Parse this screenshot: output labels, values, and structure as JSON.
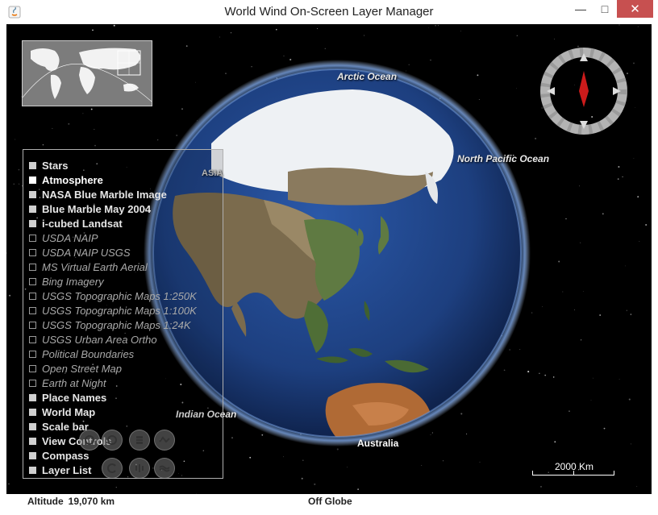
{
  "window": {
    "title": "World Wind On-Screen Layer Manager",
    "controls": {
      "minimize": "—",
      "maximize": "□",
      "close": "✕"
    }
  },
  "globe": {
    "labels": {
      "arctic": "Arctic Ocean",
      "north_pacific": "North Pacific Ocean",
      "asia": "ASIA",
      "indian": "Indian Ocean",
      "australia": "Australia"
    }
  },
  "layers": [
    {
      "label": "Stars",
      "enabled": true
    },
    {
      "label": "Atmosphere",
      "enabled": true,
      "highlighted": true
    },
    {
      "label": "NASA  Blue Marble Image",
      "enabled": true
    },
    {
      "label": "Blue Marble May 2004",
      "enabled": true
    },
    {
      "label": "i-cubed Landsat",
      "enabled": true
    },
    {
      "label": "USDA NAIP",
      "enabled": false
    },
    {
      "label": "USDA NAIP USGS",
      "enabled": false
    },
    {
      "label": "MS Virtual Earth Aerial",
      "enabled": false
    },
    {
      "label": "Bing Imagery",
      "enabled": false
    },
    {
      "label": "USGS Topographic Maps 1:250K",
      "enabled": false
    },
    {
      "label": "USGS Topographic Maps 1:100K",
      "enabled": false
    },
    {
      "label": "USGS Topographic Maps 1:24K",
      "enabled": false
    },
    {
      "label": "USGS Urban Area Ortho",
      "enabled": false
    },
    {
      "label": "Political Boundaries",
      "enabled": false
    },
    {
      "label": "Open Street Map",
      "enabled": false
    },
    {
      "label": "Earth at Night",
      "enabled": false
    },
    {
      "label": "Place Names",
      "enabled": true
    },
    {
      "label": "World Map",
      "enabled": true
    },
    {
      "label": "Scale bar",
      "enabled": true
    },
    {
      "label": "View Controls",
      "enabled": true
    },
    {
      "label": "Compass",
      "enabled": true
    },
    {
      "label": "Layer List",
      "enabled": true
    }
  ],
  "view_controls": [
    "pan-icon",
    "zoom-icon",
    "heading-icon",
    "pitch-icon",
    "look-icon",
    "fov-icon",
    "exaggeration-icon"
  ],
  "scale_bar": {
    "label": "2000 Km"
  },
  "status": {
    "altitude_label": "Altitude",
    "altitude_value": "19,070 km",
    "position_text": "Off Globe"
  },
  "colors": {
    "close_button": "#c75050",
    "compass_needle": "#cc1b1b",
    "ocean": "#1d3f7f",
    "background": "#000000"
  }
}
